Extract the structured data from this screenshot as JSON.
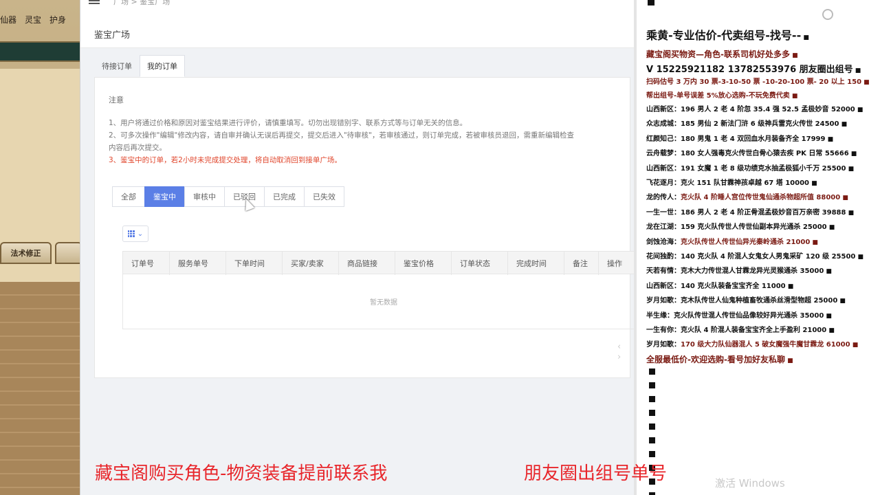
{
  "game": {
    "menu": [
      "仙器",
      "灵宝",
      "护身"
    ],
    "tab_label": "法术修正"
  },
  "web": {
    "breadcrumb": "广场 > 鉴宝广场",
    "page_title": "鉴宝广场",
    "tabs": [
      {
        "label": "待接订单",
        "active": false
      },
      {
        "label": "我的订单",
        "active": true
      }
    ],
    "notice": {
      "head": "注意",
      "lines": [
        "1、用户将通过价格和原因对鉴宝结果进行评价，请慎重填写。切勿出现错别字、联系方式等与订单无关的信息。",
        "2、可多次操作\"编辑\"修改内容，请自审并确认无误后再提交，提交后进入\"待审核\"，若审核通过，则订单完成，若被审核员退回，需重新编辑检查",
        "内容后再次提交。",
        "3、鉴宝中的订单，若2小时未完成提交处理，将自动取消回到接单广场。"
      ]
    },
    "filters": [
      {
        "label": "全部",
        "active": false
      },
      {
        "label": "鉴宝中",
        "active": true
      },
      {
        "label": "审核中",
        "active": false
      },
      {
        "label": "已驳回",
        "active": false
      },
      {
        "label": "已完成",
        "active": false
      },
      {
        "label": "已失效",
        "active": false
      }
    ],
    "table": {
      "columns": [
        "订单号",
        "服务单号",
        "下单时间",
        "买家/卖家",
        "商品链接",
        "鉴宝价格",
        "订单状态",
        "完成时间",
        "备注",
        "操作"
      ],
      "empty_text": "暂无数据"
    },
    "pager": "‹ ›"
  },
  "chat": {
    "lines": [
      {
        "text": "乘黄-专业估价-代卖组号-找号--",
        "color": "#111111",
        "size": 16
      },
      {
        "text": "藏宝阁买物资—角色-联系司机好处多多",
        "color": "#7a1a12",
        "size": 12
      },
      {
        "text": "V 15225921182  13782553976 朋友圈出组号",
        "color": "#111111",
        "size": 13
      },
      {
        "text": "扫码估号 3 万内 30 票-3-10-50 票  -10-20-100 票- 20 以上 150",
        "color": "#7a1a12",
        "size": 10
      },
      {
        "text": "帮出组号-单号误差 5%放心选购-不玩免费代卖",
        "color": "#7a1a12",
        "size": 10
      },
      {
        "name": "山西新区：",
        "text": "196 男人 2 老 4 阶忽 35.4 强 52.5 孟极妙音 52000",
        "color": "#111111",
        "size": 10
      },
      {
        "name": "众志成城：",
        "text": "185 男仙 2 新法门浒 6 级神兵雷克火传世 24500",
        "color": "#111111",
        "size": 10
      },
      {
        "name": "红颜知己：",
        "text": "180 男鬼 1 老 4 双回血水月装备齐全 17999",
        "color": "#111111",
        "size": 10
      },
      {
        "name": "云舟载梦：",
        "text": "180 女人强毒克火传世白骨心猿去疾 PK 日常 55666",
        "color": "#111111",
        "size": 10
      },
      {
        "name": "山西新区：",
        "text": "191 女魔 1 老 8 级功绩克水抽孟极狐小千万 25500",
        "color": "#111111",
        "size": 10
      },
      {
        "name": "飞花逐月：",
        "text": "克火 151 队甘霖神孩卓越 67 塔 10000",
        "color": "#111111",
        "size": 10
      },
      {
        "name": "龙的传人：",
        "text": "克火队 4 阶睡人宫位传世鬼仙通杀物超所值 88000",
        "color": "#7a1a12",
        "size": 10
      },
      {
        "name": "一生一世：",
        "text": "186 男人 2 老 4 阶正骨混孟极妙音百万亲密 39888",
        "color": "#111111",
        "size": 10
      },
      {
        "name": "龙在江湖：",
        "text": "159 克火队传世人传世仙副本异光通杀 25000",
        "color": "#111111",
        "size": 10
      },
      {
        "name": "剑蚀沧海：",
        "text": "克火队传世人传世仙异光秦岭通杀 21000",
        "color": "#7a1a12",
        "size": 10
      },
      {
        "name": "花间独酌：",
        "text": "140 克火队 4 阶混人女鬼女人男鬼采矿 120 级 25500",
        "color": "#111111",
        "size": 10
      },
      {
        "name": "天若有情：",
        "text": "克木大力传世混人甘霖龙异光灵猴通杀 35000",
        "color": "#111111",
        "size": 10
      },
      {
        "name": "山西新区：",
        "text": "140 克火队装备宝宝齐全 11000",
        "color": "#111111",
        "size": 10
      },
      {
        "name": "岁月如歌：",
        "text": "克木队传世人仙鬼种植畜牧通杀丝滑型物超 25000",
        "color": "#111111",
        "size": 10
      },
      {
        "name": "半生缘：",
        "text": "克火队传世混人传世仙品像较好异光通杀 35000",
        "color": "#111111",
        "size": 10
      },
      {
        "name": "一生有你：",
        "text": "克火队 4 阶混人装备宝宝齐全上手盈利 21000",
        "color": "#111111",
        "size": 10
      },
      {
        "name": "岁月如歌：",
        "text": "170 级大力队仙器混人 5 破女魔强牛魔甘霖龙 61000",
        "color": "#7a1a12",
        "size": 10
      },
      {
        "text": "全服最低价-欢迎选购-看号加好友私聊",
        "color": "#7a1a12",
        "size": 12
      }
    ],
    "empty_markers": 10
  },
  "overlay": {
    "caption_left": "藏宝阁购买角色-物资装备提前联系我",
    "caption_right": "朋友圈出组号单号",
    "watermark": "激活 Windows"
  },
  "colors": {
    "accent": "#5b7fe6",
    "notice_red": "#e0452b",
    "caption_red": "#e8262b"
  }
}
